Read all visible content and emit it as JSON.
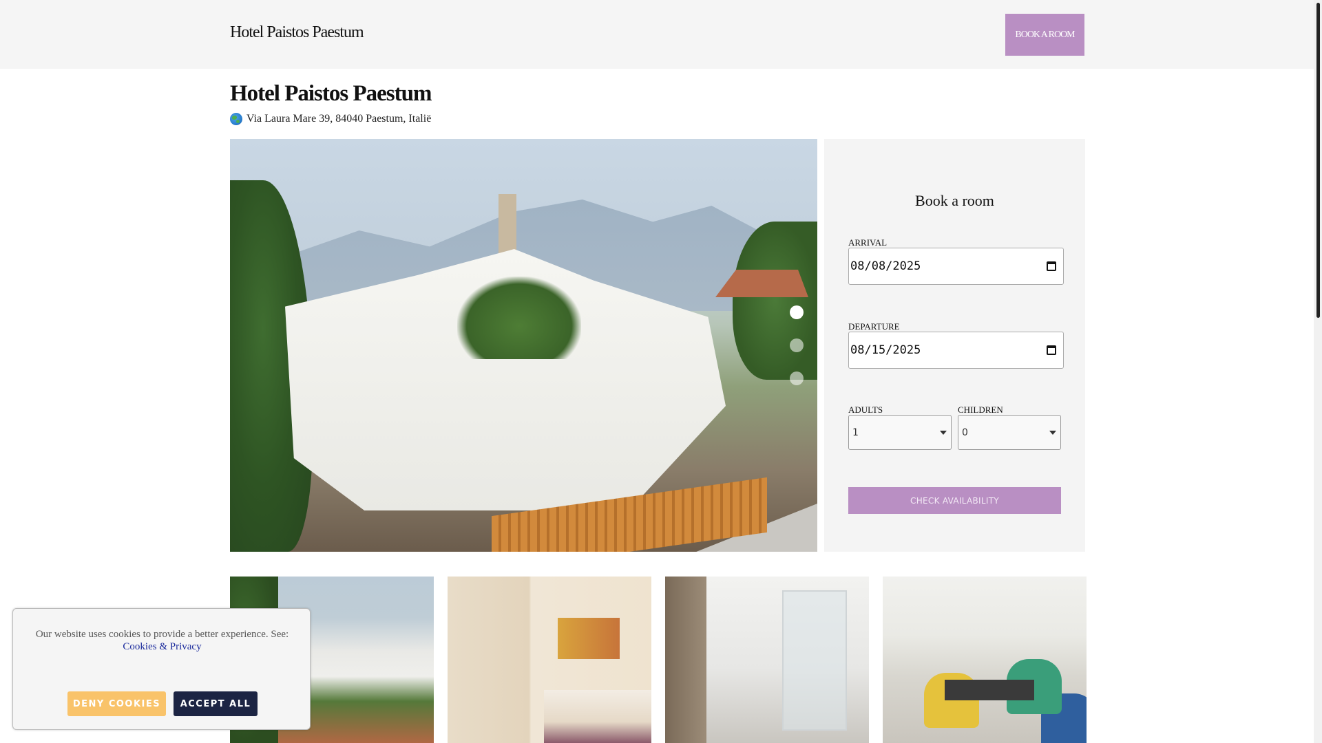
{
  "header": {
    "brand": "Hotel Paistos Paestum",
    "book_button": "BOOK A ROOM"
  },
  "hotel": {
    "title": "Hotel Paistos Paestum",
    "address": "Via Laura Mare 39, 84040 Paestum, Italië",
    "address_icon": "globe-icon"
  },
  "gallery": {
    "slide_count": 3,
    "active_slide": 1
  },
  "booking": {
    "title": "Book a room",
    "arrival_label": "ARRIVAL",
    "arrival_value": "08/08/2025",
    "departure_label": "DEPARTURE",
    "departure_value": "08/15/2025",
    "adults_label": "ADULTS",
    "adults_value": "1",
    "children_label": "CHILDREN",
    "children_value": "0",
    "check_button": "CHECK AVAILABILITY"
  },
  "thumbnails": [
    "hotel exterior",
    "guest room",
    "bathroom",
    "restaurant"
  ],
  "cookie_banner": {
    "text": "Our website uses cookies to provide a better experience. See:",
    "link": "Cookies & Privacy",
    "deny_button": "DENY COOKIES",
    "accept_button": "ACCEPT ALL"
  },
  "colors": {
    "accent": "#b98fc3",
    "deny": "#f9c36a",
    "accept": "#1c2443"
  }
}
